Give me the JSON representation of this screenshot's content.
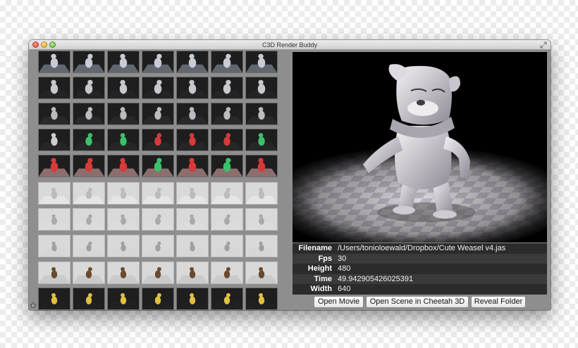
{
  "window": {
    "title": "C3D Render Buddy"
  },
  "info": {
    "rows": [
      {
        "label": "Filename",
        "value": "/Users/tonioloewald/Dropbox/Cute Weasel v4.jas"
      },
      {
        "label": "Fps",
        "value": "30"
      },
      {
        "label": "Height",
        "value": "480"
      },
      {
        "label": "Time",
        "value": "49.942905426025391"
      },
      {
        "label": "Width",
        "value": "640"
      }
    ]
  },
  "buttons": {
    "open_movie": "Open Movie",
    "open_scene": "Open Scene in Cheetah 3D",
    "reveal_folder": "Reveal Folder"
  },
  "icons": {
    "traffic_lights": [
      "close-icon",
      "minimize-icon",
      "zoom-icon"
    ],
    "fullscreen": "fullscreen-icon",
    "corner": "home-icon"
  },
  "colors": {
    "window_bg": "#8e8e8e",
    "preview_bg": "#000000",
    "info_row_dark": "#2b2b2b",
    "info_row_light": "#3a3a3a"
  }
}
